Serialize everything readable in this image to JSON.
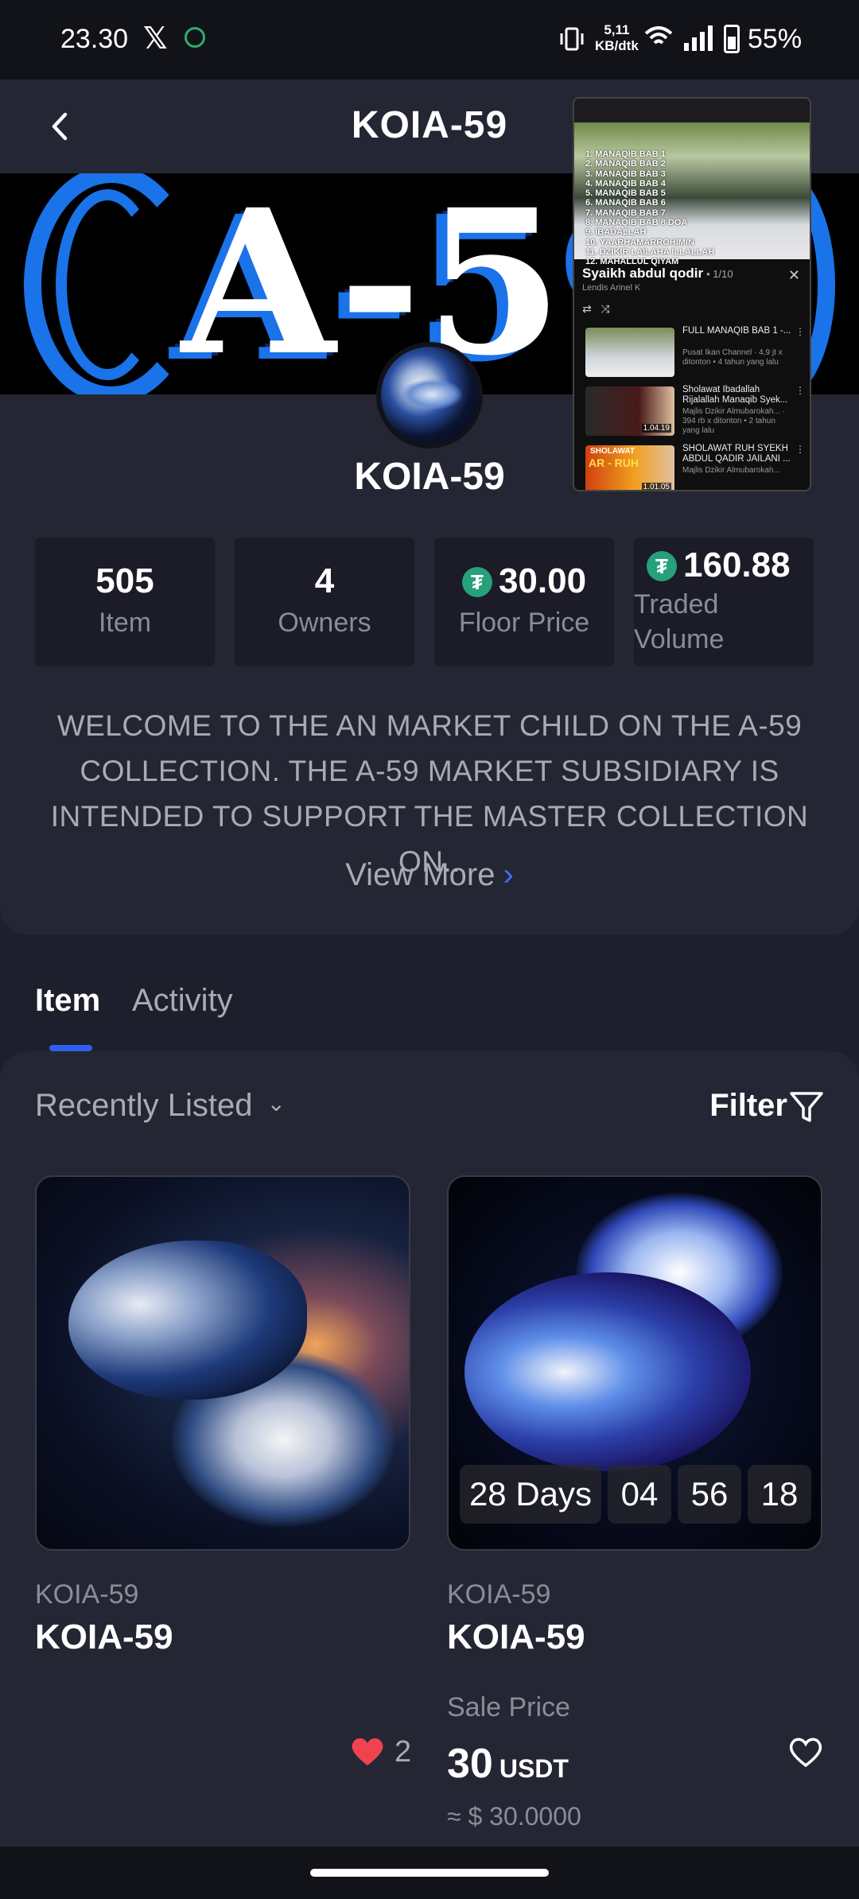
{
  "status_bar": {
    "time": "23.30",
    "speed_line1": "5,11",
    "speed_line2": "KB/dtk",
    "battery": "55%"
  },
  "header": {
    "title": "KOIA-59",
    "back_icon": "chevron-left-icon"
  },
  "banner": {
    "text": "A-59"
  },
  "collection": {
    "name": "KOIA-59",
    "stats": [
      {
        "value": "505",
        "label": "Item"
      },
      {
        "value": "4",
        "label": "Owners"
      },
      {
        "value": "30.00",
        "label": "Floor Price",
        "icon": "tether-icon"
      },
      {
        "value": "160.88",
        "label": "Traded Volume",
        "icon": "tether-icon"
      }
    ],
    "stat4_label_line1": "Traded",
    "stat4_label_line2": "Volume",
    "description_lines": [
      "WELCOME TO THE AN MARKET CHILD ON THE A-59",
      "COLLECTION. THE A-59 MARKET SUBSIDIARY IS",
      "INTENDED TO SUPPORT THE MASTER COLLECTION ON.."
    ],
    "view_more": "View More"
  },
  "tabs": [
    {
      "label": "Item",
      "active": true
    },
    {
      "label": "Activity",
      "active": false
    }
  ],
  "list": {
    "sort_label": "Recently Listed",
    "filter_label": "Filter",
    "cards": [
      {
        "collection": "KOIA-59",
        "name": "KOIA-59",
        "likes": "2",
        "liked": true
      },
      {
        "collection": "KOIA-59",
        "name": "KOIA-59",
        "timer": {
          "days": "28 Days",
          "hours": "04",
          "minutes": "56",
          "seconds": "18"
        },
        "sale_label": "Sale Price",
        "price": "30",
        "currency": "USDT",
        "usd": "≈ $ 30.0000",
        "liked": false
      }
    ]
  },
  "pip_overlay": {
    "video_lines": [
      "1. MANAQIB BAB 1",
      "2. MANAQIB BAB 2",
      "3. MANAQIB BAB 3",
      "4. MANAQIB BAB 4",
      "5. MANAQIB BAB 5",
      "6. MANAQIB BAB 6",
      "7. MANAQIB BAB 7",
      "8. MANAQIB BAB 8 DOA",
      "9. IBADALLAH",
      "10. YAARHAMARROHIMIN",
      "11. DZIKIR LAILAHA ILLALLAH",
      "12. MAHALLUL QIYAM"
    ],
    "playlist_title": "Syaikh abdul qodir",
    "playlist_count": "• 1/10",
    "channel": "Lendis Arinel K",
    "items": [
      {
        "title": "FULL MANAQIB BAB 1 -...",
        "meta": "Pusat Ikan Channel · 4,9 jt x ditonton • 4 tahun yang lalu"
      },
      {
        "title": "Sholawat Ibadallah Rijalallah Manaqib Syek...",
        "meta": "Majlis Dzikir Almubarokah... · 394 rb x ditonton • 2 tahun yang lalu",
        "duration": "1.04.19"
      },
      {
        "title": "SHOLAWAT RUH SYEKH ABDUL QADIR JAILANI ...",
        "meta": "Majlis Dzikir Almubarokah...",
        "duration": "1.01.05",
        "thumb_text1": "SHOLAWAT",
        "thumb_text2": "AR - RUH"
      }
    ]
  }
}
